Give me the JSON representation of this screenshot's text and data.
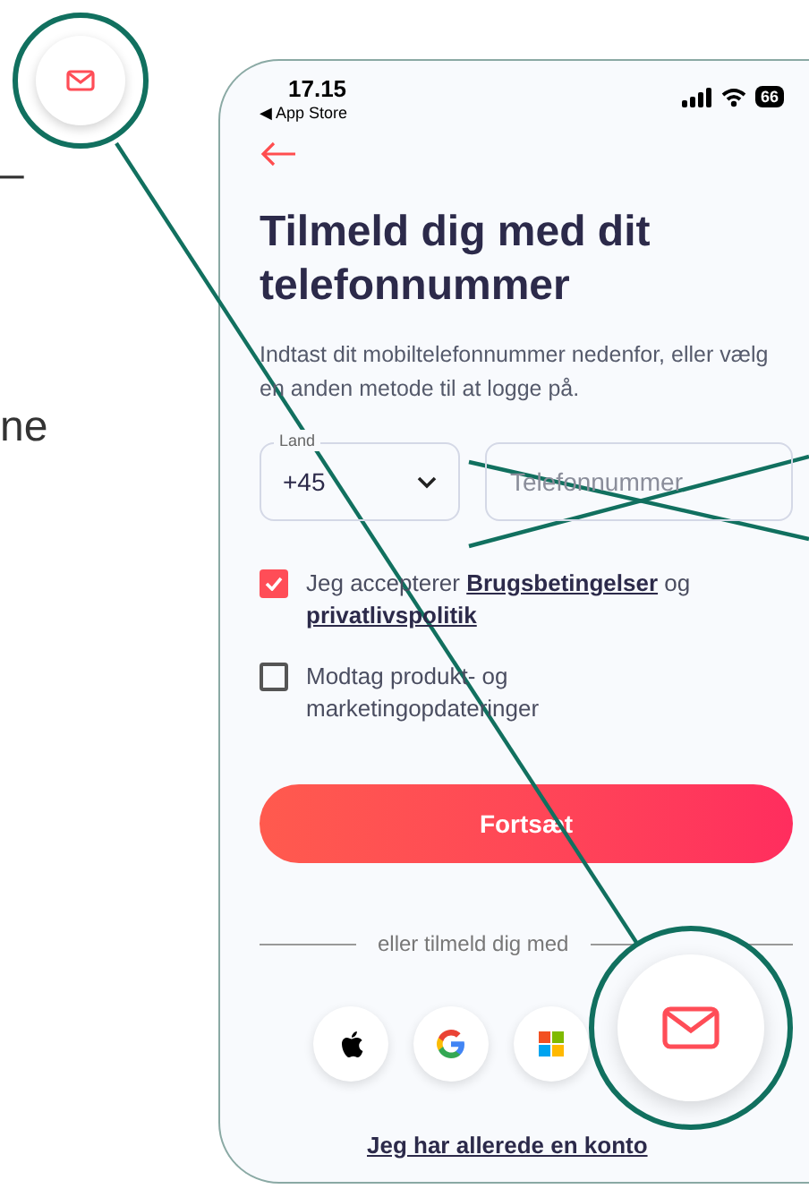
{
  "page_fragments": [
    "–",
    "ne"
  ],
  "status_bar": {
    "time": "17.15",
    "back_label": "◀ App Store",
    "battery": "66"
  },
  "title": "Tilmeld dig med dit telefonnummer",
  "subtitle": "Indtast dit mobiltelefonnummer nedenfor, eller vælg en anden metode til at logge på.",
  "country_field": {
    "label": "Land",
    "value": "+45"
  },
  "phone_field": {
    "placeholder": "Telefonnummer"
  },
  "consents": [
    {
      "checked": true,
      "parts": [
        {
          "kind": "text",
          "text": "Jeg accepterer "
        },
        {
          "kind": "link",
          "text": "Brugsbetingelser"
        },
        {
          "kind": "text",
          "text": " og "
        },
        {
          "kind": "link",
          "text": "privatlivspolitik"
        }
      ]
    },
    {
      "checked": false,
      "parts": [
        {
          "kind": "text",
          "text": "Modtag produkt- og marketingopdateringer"
        }
      ]
    }
  ],
  "continue_button": "Fortsæt",
  "divider_text": "eller tilmeld dig med",
  "social_buttons": [
    {
      "kind": "apple"
    },
    {
      "kind": "google"
    },
    {
      "kind": "microsoft"
    },
    {
      "kind": "email"
    }
  ],
  "login_link": "Jeg har allerede en konto"
}
